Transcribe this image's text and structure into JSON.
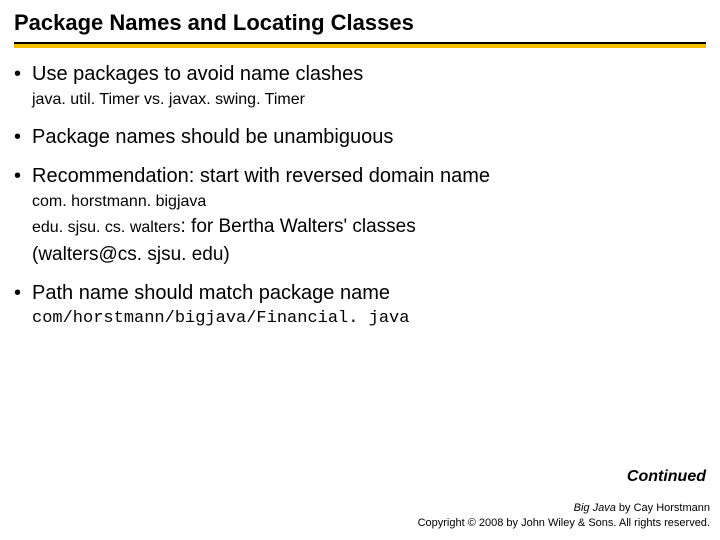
{
  "title": "Package Names and Locating Classes",
  "bullets": {
    "b1": {
      "text": "Use packages to avoid name clashes",
      "sub1": "java. util. Timer vs. javax. swing. Timer"
    },
    "b2": {
      "text": "Package names should be unambiguous"
    },
    "b3": {
      "text": "Recommendation: start with reversed domain name",
      "sub1": "com. horstmann. bigjava",
      "sub2a": "edu. sjsu. cs. walters",
      "sub2b": ": for Bertha Walters' classes",
      "sub3": "(walters@cs. sjsu. edu)"
    },
    "b4": {
      "text": "Path name should match package name",
      "sub1": "com/horstmann/bigjava/Financial. java"
    }
  },
  "continued": "Continued",
  "footer": {
    "book": "Big Java",
    "byline": " by Cay Horstmann",
    "copyright": "Copyright © 2008 by John Wiley & Sons. All rights reserved."
  }
}
